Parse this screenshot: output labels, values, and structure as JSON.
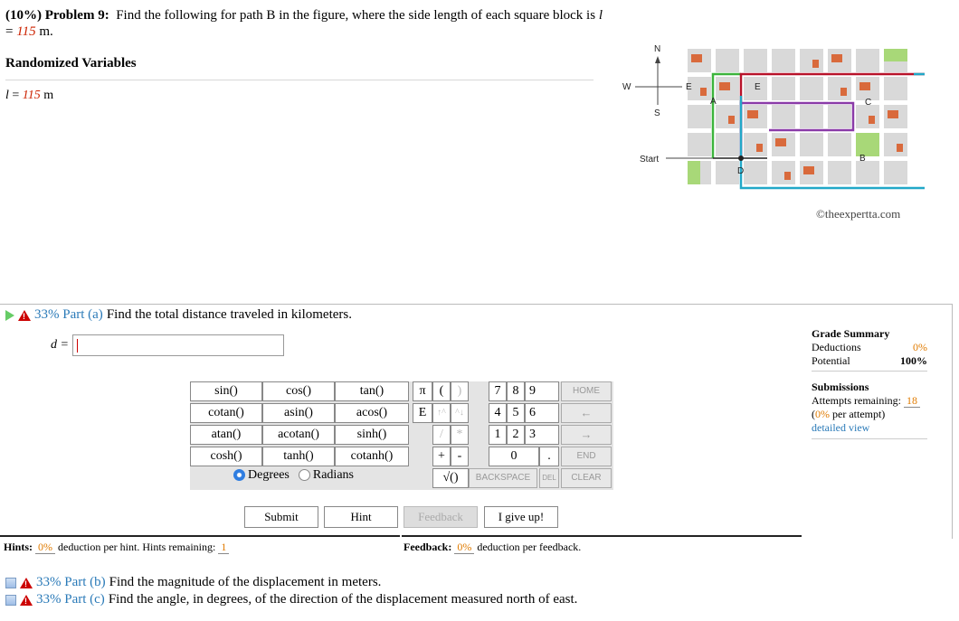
{
  "problem": {
    "title_prefix": "(10%) Problem 9:",
    "title_text": "Find the following for path B in the figure, where the side length of each square block is",
    "title_var": "l",
    "title_eq": " = ",
    "title_value": "115",
    "title_unit": " m."
  },
  "randomized": {
    "heading": "Randomized Variables",
    "var": "l",
    "eq": " = ",
    "value": "115",
    "unit": " m"
  },
  "figure": {
    "compass": {
      "n": "N",
      "s": "S",
      "e": "E",
      "w": "W"
    },
    "start_label": "Start",
    "path_labels": [
      "A",
      "B",
      "C",
      "D",
      "E"
    ],
    "watermark": "©theexpertta.com",
    "colors": {
      "green": "#3cb43c",
      "red": "#b8132a",
      "purple": "#8a3aa8",
      "cyan": "#22a8c8",
      "block": "#d9d9d9",
      "house": "#d96a3c",
      "park": "#a8d878"
    }
  },
  "part_a": {
    "percent": "33% Part (a)",
    "question": "Find the total distance traveled in kilometers.",
    "input_label": "d =",
    "input_value": ""
  },
  "calculator": {
    "func_rows": [
      [
        "sin()",
        "cos()",
        "tan()"
      ],
      [
        "cotan()",
        "asin()",
        "acos()"
      ],
      [
        "atan()",
        "acotan()",
        "sinh()"
      ],
      [
        "cosh()",
        "tanh()",
        "cotanh()"
      ]
    ],
    "keys": {
      "pi": "π",
      "lparen": "(",
      "rparen": ")",
      "e": "E",
      "up": "↑^",
      "down": "^↓",
      "slash": "/",
      "star": "*",
      "plus": "+",
      "minus": "-",
      "sqrt": "√()",
      "n7": "7",
      "n8": "8",
      "n9": "9",
      "n4": "4",
      "n5": "5",
      "n6": "6",
      "n1": "1",
      "n2": "2",
      "n3": "3",
      "n0": "0",
      "dot": ".",
      "home": "HOME",
      "left": "←",
      "right": "→",
      "end": "END",
      "backspace": "BACKSPACE",
      "del": "DEL",
      "clear": "CLEAR"
    },
    "degrees": "Degrees",
    "radians": "Radians",
    "selected": "Degrees"
  },
  "actions": {
    "submit": "Submit",
    "hint": "Hint",
    "feedback": "Feedback",
    "give_up": "I give up!"
  },
  "grade_summary": {
    "title": "Grade Summary",
    "deductions_label": "Deductions",
    "deductions_value": "0%",
    "potential_label": "Potential",
    "potential_value": "100%",
    "submissions_title": "Submissions",
    "attempts_label": "Attempts remaining:",
    "attempts_value": "18",
    "per_attempt_value": "0%",
    "per_attempt_label": " per attempt)",
    "detailed_view": "detailed view"
  },
  "hints": {
    "label": "Hints:",
    "value": "0%",
    "text": "deduction per hint. Hints remaining:",
    "remaining": "1"
  },
  "feedback": {
    "label": "Feedback:",
    "value": "0%",
    "text": "deduction per feedback."
  },
  "part_b": {
    "percent": "33% Part (b)",
    "question": "Find the magnitude of the displacement in meters."
  },
  "part_c": {
    "percent": "33% Part (c)",
    "question": "Find the angle, in degrees, of the direction of the displacement measured north of east."
  }
}
